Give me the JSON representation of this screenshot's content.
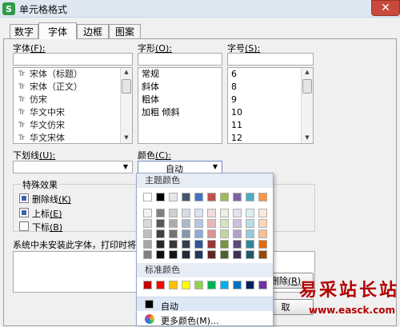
{
  "window": {
    "title": "单元格格式",
    "app_icon_letter": "S",
    "close_glyph": "✕"
  },
  "tabs": [
    {
      "label": "数字",
      "active": false
    },
    {
      "label": "字体",
      "active": true
    },
    {
      "label": "边框",
      "active": false
    },
    {
      "label": "图案",
      "active": false
    }
  ],
  "font": {
    "label": "字体",
    "shortcut": "(F):",
    "items": [
      "宋体（标题）",
      "宋体（正文）",
      "仿宋",
      "华文中宋",
      "华文仿宋",
      "华文宋体"
    ],
    "item_icon": "Tr"
  },
  "style": {
    "label": "字形",
    "shortcut": "(O):",
    "items": [
      "常规",
      "斜体",
      "粗体",
      "加粗 倾斜"
    ]
  },
  "size": {
    "label": "字号",
    "shortcut": "(S):",
    "items": [
      "6",
      "8",
      "9",
      "10",
      "11",
      "12"
    ]
  },
  "underline": {
    "label": "下划线",
    "shortcut": "(U):"
  },
  "color": {
    "label": "颜色",
    "shortcut": "(C):",
    "selected": "自动"
  },
  "effects": {
    "title": "特殊效果",
    "strikethrough": "删除线",
    "strikethrough_key": "(K)",
    "superscript": "上标",
    "superscript_key": "(E)",
    "subscript": "下标",
    "subscript_key": "(B)"
  },
  "note": "系统中未安装此字体，打印时将采",
  "buttons": {
    "clear": "删除",
    "clear_key": "(R)",
    "ok": "取"
  },
  "color_popup": {
    "theme_header": "主题颜色",
    "standard_header": "标准颜色",
    "auto_label": "自动",
    "more_label": "更多颜色(M)...",
    "theme_row": [
      "#ffffff",
      "#000000",
      "#e7e6e6",
      "#44546a",
      "#4472c4",
      "#c0504d",
      "#9bbb59",
      "#8064a2",
      "#4bacc6",
      "#f79646"
    ],
    "theme_tints": [
      [
        "#f2f2f2",
        "#7f7f7f",
        "#d0cece",
        "#d6dce5",
        "#dae3f3",
        "#f2dcdb",
        "#ebf1de",
        "#e5e0ec",
        "#dbeef4",
        "#fde9d9"
      ],
      [
        "#d9d9d9",
        "#595959",
        "#aeabab",
        "#adb9ca",
        "#b4c7e7",
        "#e6b9b8",
        "#d7e4bd",
        "#ccc1da",
        "#b7dee8",
        "#fcd5b5"
      ],
      [
        "#bfbfbf",
        "#404040",
        "#757171",
        "#8497b0",
        "#8faadc",
        "#d99694",
        "#c3d69b",
        "#b3a2c7",
        "#93cddd",
        "#fac090"
      ],
      [
        "#a6a6a6",
        "#262626",
        "#3a3838",
        "#333f50",
        "#2f5597",
        "#953735",
        "#77933c",
        "#604a7b",
        "#31859c",
        "#e46c0a"
      ],
      [
        "#808080",
        "#0d0d0d",
        "#171616",
        "#222a35",
        "#203864",
        "#632523",
        "#4f6228",
        "#403152",
        "#215968",
        "#984807"
      ]
    ],
    "standard_row": [
      "#c00000",
      "#ff0000",
      "#ffc000",
      "#ffff00",
      "#92d050",
      "#00b050",
      "#00b0f0",
      "#0070c0",
      "#002060",
      "#7030a0"
    ],
    "auto_swatch": "#000000"
  },
  "watermark": {
    "text": "易采站长站",
    "url": "www.easck.com"
  }
}
